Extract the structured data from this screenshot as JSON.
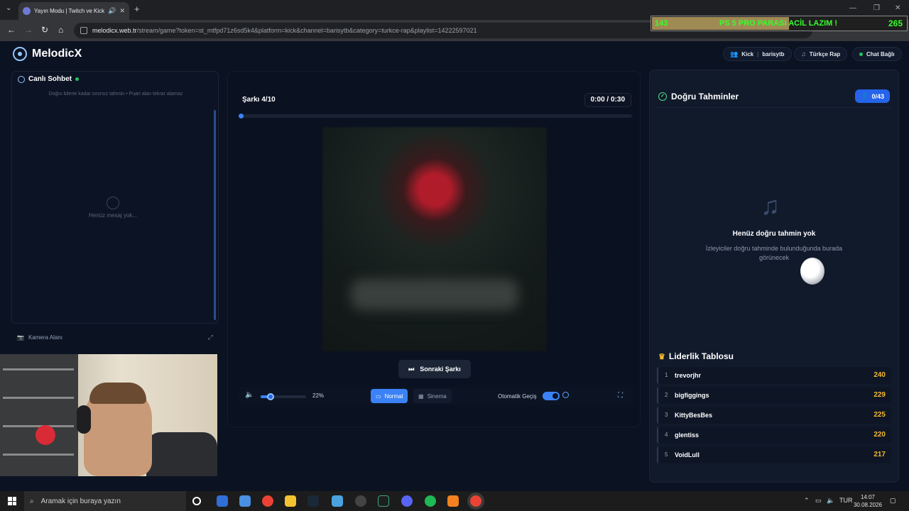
{
  "browser": {
    "tab_title": "Yayın Modu | Twitch ve Kick",
    "url_host": "melodicx.web.tr",
    "url_path": "/stream/game?token=st_mtfpd71z6sd5k4&platform=kick&channel=barisytb&category=turkce-rap&playlist=14222597021"
  },
  "overlay": {
    "left_value": "143",
    "message": "PS 5 PRO PARASI ACİL LAZIM !",
    "right_value": "265",
    "progress_fraction": 0.54
  },
  "header": {
    "logo": "MelodicX",
    "platform": "Kick",
    "channel": "barisytb",
    "category": "Türkçe Rap",
    "chat_status": "Chat Bağlı"
  },
  "chat": {
    "title": "Canlı Sohbet",
    "subtitle": "Doğru bilene kadar sınırsız tahmin • Puan alan tekrar alamaz",
    "empty": "Henüz mesaj yok..."
  },
  "camera": {
    "title": "Kamera Alanı"
  },
  "player": {
    "song_counter": "Şarkı 4/10",
    "time_current": "0:00",
    "time_sep": "/",
    "time_total": "0:30",
    "progress_fraction": 0.0,
    "next_button": "Sonraki Şarkı",
    "volume_percent_label": "22%",
    "volume_fraction": 0.22,
    "mode_normal": "Normal",
    "mode_cinema": "Sinema",
    "auto_label": "Otomatik Geçiş",
    "auto_enabled": true
  },
  "correct": {
    "title": "Doğru Tahminler",
    "count": "0/43",
    "empty_title": "Henüz doğru tahmin yok",
    "empty_desc": "İzleyiciler doğru tahminde bulunduğunda burada görünecek"
  },
  "leaderboard": {
    "title": "Liderlik Tablosu",
    "rows": [
      {
        "rank": "1",
        "name": "trevorjhr",
        "score": "240"
      },
      {
        "rank": "2",
        "name": "bigfiggings",
        "score": "229"
      },
      {
        "rank": "3",
        "name": "KittyBesBes",
        "score": "225"
      },
      {
        "rank": "4",
        "name": "glentiss",
        "score": "220"
      },
      {
        "rank": "5",
        "name": "VoidLull",
        "score": "217"
      }
    ]
  },
  "taskbar": {
    "search_placeholder": "Aramak için buraya yazın",
    "lang": "TUR",
    "time": "14:07",
    "date": "30.08.2026"
  },
  "colors": {
    "accent": "#3b82f6",
    "score": "#f5b82e",
    "online": "#22c55e"
  }
}
